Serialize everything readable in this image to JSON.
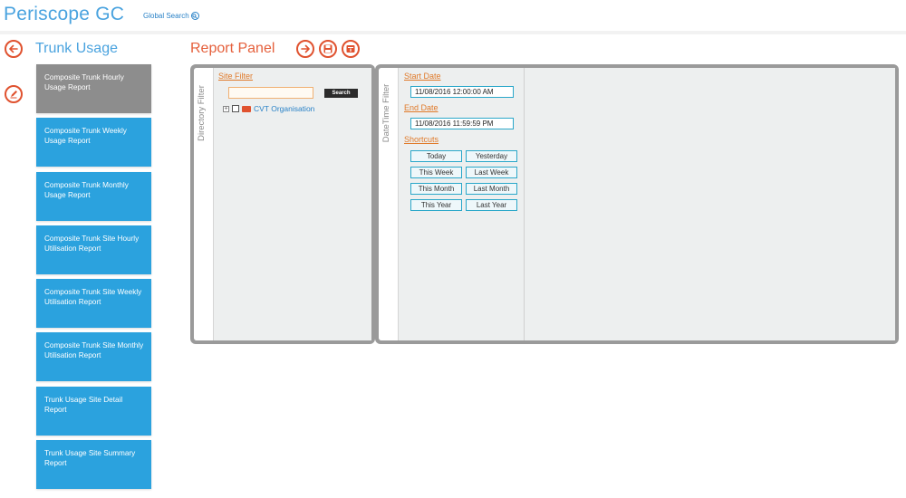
{
  "header": {
    "app_title": "Periscope GC",
    "global_search_label": "Global Search"
  },
  "sidebar": {
    "title": "Trunk Usage",
    "reports": [
      {
        "label": "Composite Trunk Hourly Usage Report",
        "active": true
      },
      {
        "label": "Composite Trunk Weekly Usage Report",
        "active": false
      },
      {
        "label": "Composite Trunk Monthly Usage Report",
        "active": false
      },
      {
        "label": "Composite Trunk Site Hourly Utilisation Report",
        "active": false
      },
      {
        "label": "Composite Trunk Site Weekly Utilisation Report",
        "active": false
      },
      {
        "label": "Composite Trunk Site Monthly Utilisation Report",
        "active": false
      },
      {
        "label": "Trunk Usage Site Detail Report",
        "active": false
      },
      {
        "label": "Trunk Usage Site Summary Report",
        "active": false
      }
    ]
  },
  "report_panel": {
    "title": "Report Panel",
    "directory_filter": {
      "tab_label": "Directory Filter",
      "site_filter_label": "Site Filter",
      "site_filter_value": "",
      "search_button": "Search",
      "tree": {
        "org_label": "CVT Organisation",
        "checked": false
      }
    },
    "datetime_filter": {
      "tab_label": "DateTime Filter",
      "start_date_label": "Start Date",
      "start_date_value": "11/08/2016 12:00:00 AM",
      "end_date_label": "End Date",
      "end_date_value": "11/08/2016 11:59:59 PM",
      "shortcuts_label": "Shortcuts",
      "shortcuts": [
        "Today",
        "Yesterday",
        "This Week",
        "Last Week",
        "This Month",
        "Last Month",
        "This Year",
        "Last Year"
      ]
    }
  },
  "icons": {
    "back": "arrow-left-icon",
    "edit": "pencil-icon",
    "run": "arrow-right-icon",
    "save": "save-icon",
    "schedule": "export-icon",
    "search": "magnifier-icon"
  },
  "colors": {
    "brand_blue": "#4aa3df",
    "tile_blue": "#2ba2de",
    "tile_active": "#8d8d8d",
    "accent_orange": "#e0522f",
    "link_orange": "#e07a2a"
  }
}
